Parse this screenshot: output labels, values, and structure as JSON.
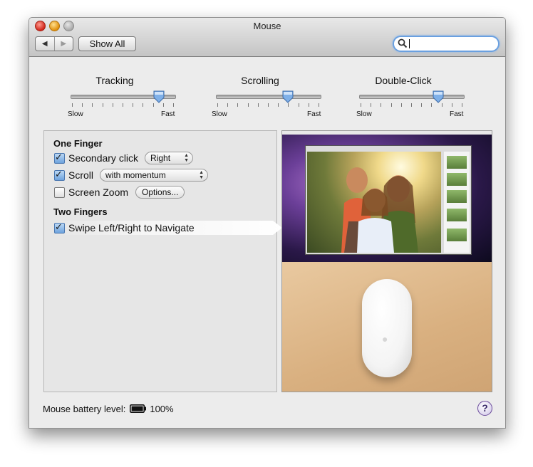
{
  "window": {
    "title": "Mouse"
  },
  "toolbar": {
    "back_icon": "◀",
    "forward_icon": "▶",
    "show_all_label": "Show All",
    "search_value": ""
  },
  "sliders": [
    {
      "label": "Tracking",
      "min_label": "Slow",
      "max_label": "Fast",
      "value": 0.86
    },
    {
      "label": "Scrolling",
      "min_label": "Slow",
      "max_label": "Fast",
      "value": 0.7
    },
    {
      "label": "Double-Click",
      "min_label": "Slow",
      "max_label": "Fast",
      "value": 0.77
    }
  ],
  "gestures": {
    "one_finger_heading": "One Finger",
    "secondary_click": {
      "label": "Secondary click",
      "checked": true,
      "option": "Right"
    },
    "scroll": {
      "label": "Scroll",
      "checked": true,
      "option": "with momentum"
    },
    "screen_zoom": {
      "label": "Screen Zoom",
      "checked": false,
      "button": "Options..."
    },
    "two_fingers_heading": "Two Fingers",
    "swipe": {
      "label": "Swipe Left/Right to Navigate",
      "checked": true
    }
  },
  "battery": {
    "label": "Mouse battery level:",
    "value": "100%",
    "level": 1.0
  },
  "help": {
    "label": "?"
  },
  "colors": {
    "accent": "#6aa0e0",
    "window_bg": "#ececec",
    "panel_bg": "#e6e6e6"
  }
}
